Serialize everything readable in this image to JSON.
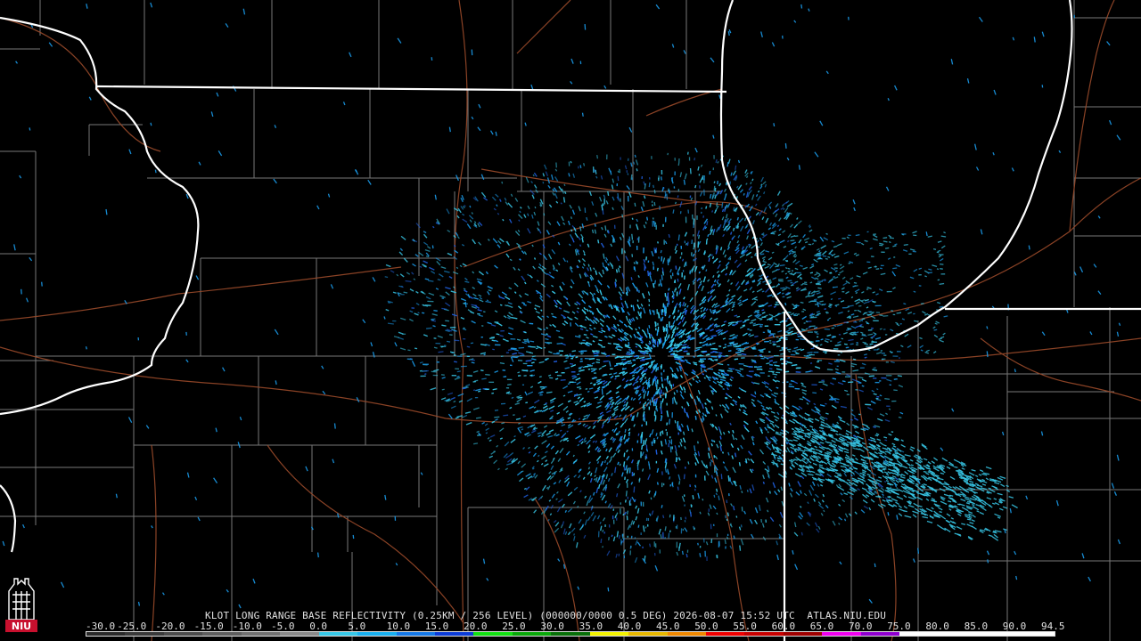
{
  "product": {
    "title_line": "KLOT LONG RANGE BASE REFLECTIVITY (0.25KM / 256 LEVEL) (000000/0000 0.5 DEG) 2026-08-07 15:52 UTC  ATLAS.NIU.EDU"
  },
  "color_scale": {
    "labels": [
      "-30.0",
      "-25.0",
      "-20.0",
      "-15.0",
      "-10.0",
      "-5.0",
      "0.0",
      "5.0",
      "10.0",
      "15.0",
      "20.0",
      "25.0",
      "30.0",
      "35.0",
      "40.0",
      "45.0",
      "50.0",
      "55.0",
      "60.0",
      "65.0",
      "70.0",
      "75.0",
      "80.0",
      "85.0",
      "90.0",
      "94.5"
    ],
    "colors": [
      "#2a2a2a",
      "#3a3a3a",
      "#4c4c4c",
      "#5e5e5e",
      "#707070",
      "#8a8a8a",
      "#36c8e8",
      "#18b0f0",
      "#1478e8",
      "#0c3cd8",
      "#12e012",
      "#0aa80a",
      "#087008",
      "#f2f200",
      "#e8b800",
      "#f08800",
      "#f00000",
      "#c80000",
      "#a00000",
      "#f000f0",
      "#9000d0",
      "#ffffff",
      "#ffffff",
      "#ffffff",
      "#ffffff"
    ]
  },
  "logo": {
    "text": "NIU",
    "color": "#c8102e"
  },
  "map_colors": {
    "state_borders": "#ffffff",
    "county_lines": "#8c8c8c",
    "highways": "#9a4a2a",
    "echo_light": "#38c8e8",
    "echo_mid": "#1a9ae8",
    "echo_dark": "#2060e0",
    "background": "#000000"
  },
  "radar": {
    "site": "KLOT"
  }
}
